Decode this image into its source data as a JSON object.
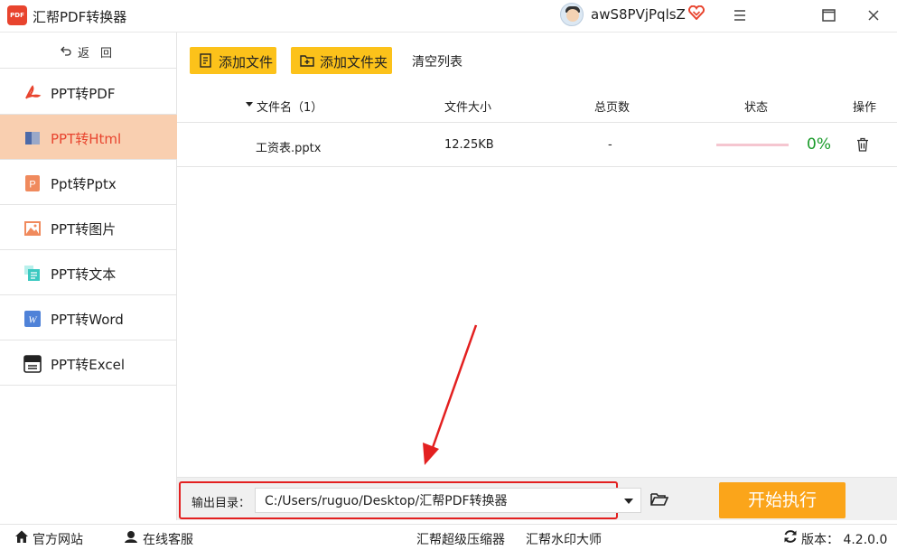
{
  "app": {
    "title": "汇帮PDF转换器",
    "logo_text": "PDF",
    "username": "awS8PVjPqlsZ"
  },
  "sidebar": {
    "back_label": "返回",
    "items": [
      {
        "label": "PPT转PDF",
        "icon": "pdf-icon",
        "active": false
      },
      {
        "label": "PPT转Html",
        "icon": "html-icon",
        "active": true
      },
      {
        "label": "Ppt转Pptx",
        "icon": "pptx-icon",
        "active": false
      },
      {
        "label": "PPT转图片",
        "icon": "image-icon",
        "active": false
      },
      {
        "label": "PPT转文本",
        "icon": "text-icon",
        "active": false
      },
      {
        "label": "PPT转Word",
        "icon": "word-icon",
        "active": false
      },
      {
        "label": "PPT转Excel",
        "icon": "excel-icon",
        "active": false
      }
    ]
  },
  "toolbar": {
    "add_file": "添加文件",
    "add_folder": "添加文件夹",
    "clear_list": "清空列表"
  },
  "table": {
    "columns": {
      "filename": "文件名（1）",
      "size": "文件大小",
      "pages": "总页数",
      "status": "状态",
      "action": "操作"
    },
    "rows": [
      {
        "filename": "工资表.pptx",
        "size": "12.25KB",
        "pages": "-",
        "progress": 0,
        "progress_text": "0%"
      }
    ]
  },
  "output": {
    "label": "输出目录：",
    "path": "C:/Users/ruguo/Desktop/汇帮PDF转换器",
    "start": "开始执行"
  },
  "footer": {
    "website": "官方网站",
    "support": "在线客服",
    "compressor": "汇帮超级压缩器",
    "watermark": "汇帮水印大师",
    "version": "版本：  4.2.0.0"
  },
  "colors": {
    "accent": "#fcc21a",
    "active_bg": "#f9cfb0",
    "active_text": "#e8442e",
    "start": "#fba51a",
    "highlight": "#e32020",
    "progress_text": "#1a9b2a"
  }
}
